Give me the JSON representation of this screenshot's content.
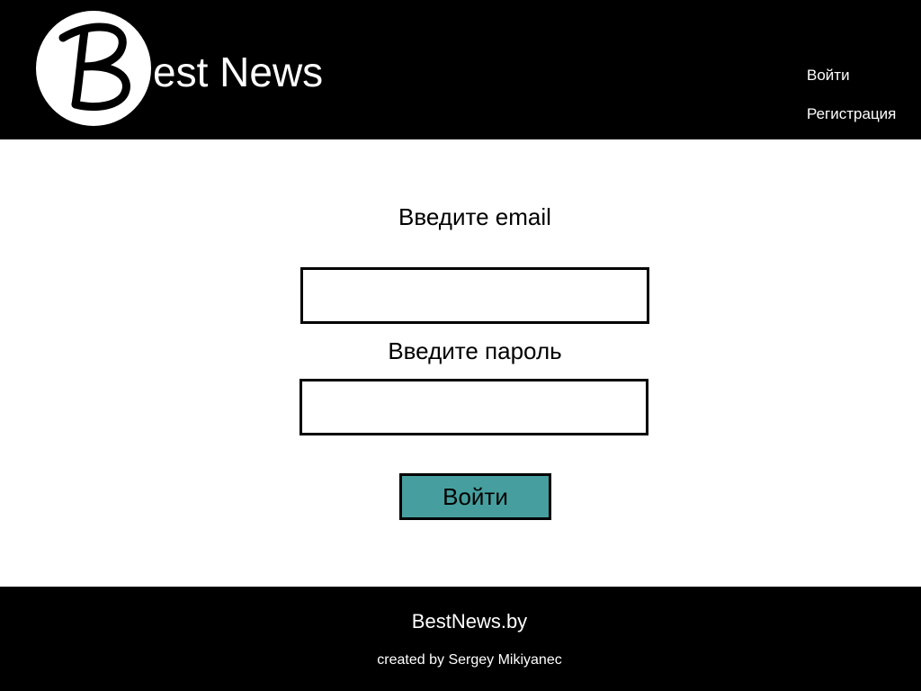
{
  "header": {
    "logo_text": "est News",
    "logo_letter": "B",
    "nav": {
      "login_label": "Войти",
      "register_label": "Регистрация"
    }
  },
  "form": {
    "email_label": "Введите email",
    "email_value": "",
    "password_label": "Введите пароль",
    "password_value": "",
    "submit_label": "Войти"
  },
  "footer": {
    "site": "BestNews.by",
    "credit": "created by Sergey Mikiyanec"
  },
  "colors": {
    "header_bg": "#000000",
    "footer_bg": "#000000",
    "button_bg": "#469f9e"
  }
}
